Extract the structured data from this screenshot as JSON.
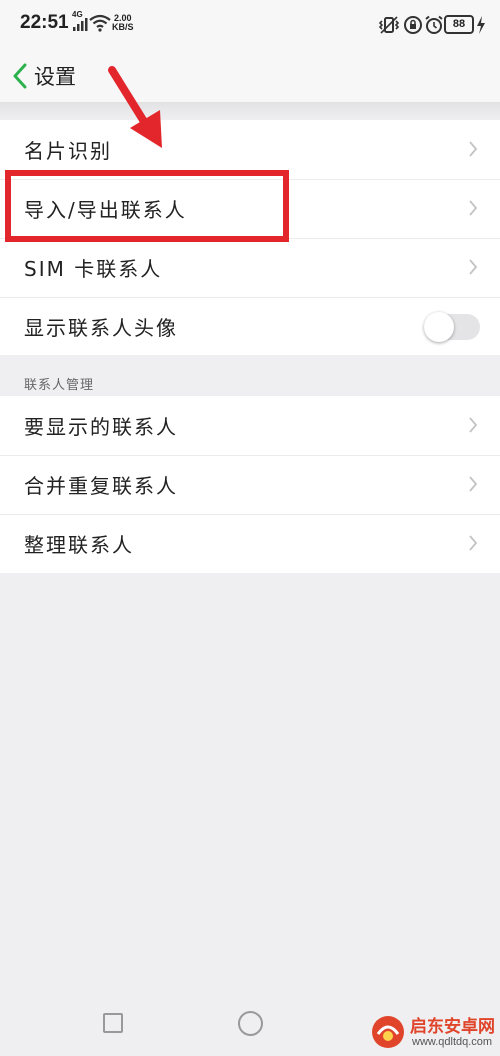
{
  "status_bar": {
    "time": "22:51",
    "network_type": "4G",
    "speed_value": "2.00",
    "speed_unit": "KB/S",
    "battery": "88"
  },
  "header": {
    "title": "设置"
  },
  "group1": {
    "items": [
      {
        "label": "名片识别"
      },
      {
        "label": "导入/导出联系人"
      },
      {
        "label": "SIM 卡联系人"
      },
      {
        "label": "显示联系人头像",
        "toggle_on": false
      }
    ]
  },
  "section2": {
    "header": "联系人管理",
    "items": [
      {
        "label": "要显示的联系人"
      },
      {
        "label": "合并重复联系人"
      },
      {
        "label": "整理联系人"
      }
    ]
  },
  "watermark": {
    "name": "启东安卓网",
    "url": "www.qdltdq.com"
  },
  "colors": {
    "accent": "#2bb24c",
    "annotation": "#e3262b",
    "background": "#efeff1"
  }
}
